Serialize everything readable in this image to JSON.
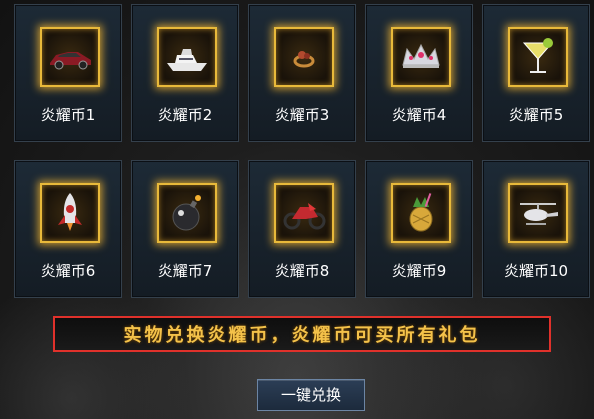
{
  "items": [
    {
      "label": "炎耀币1",
      "icon": "sports-car-icon"
    },
    {
      "label": "炎耀币2",
      "icon": "yacht-icon"
    },
    {
      "label": "炎耀币3",
      "icon": "ring-icon"
    },
    {
      "label": "炎耀币4",
      "icon": "tiara-icon"
    },
    {
      "label": "炎耀币5",
      "icon": "cocktail-icon"
    },
    {
      "label": "炎耀币6",
      "icon": "rocket-icon"
    },
    {
      "label": "炎耀币7",
      "icon": "bomb-icon"
    },
    {
      "label": "炎耀币8",
      "icon": "motorcycle-icon"
    },
    {
      "label": "炎耀币9",
      "icon": "pineapple-drink-icon"
    },
    {
      "label": "炎耀币10",
      "icon": "helicopter-icon"
    }
  ],
  "banner": {
    "text": "实物兑换炎耀币，炎耀币可买所有礼包"
  },
  "button": {
    "label": "一键兑换"
  },
  "colors": {
    "frame_gold": "#e8b93a",
    "banner_border": "#e0312b",
    "banner_text": "#f4c24a"
  }
}
